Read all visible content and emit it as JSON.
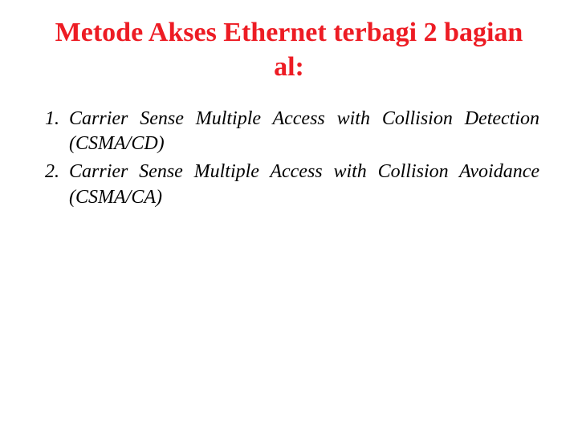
{
  "title": "Metode Akses Ethernet terbagi 2 bagian al:",
  "items": [
    "Carrier Sense Multiple Access with Collision Detection (CSMA/CD)",
    "Carrier Sense Multiple Access with Collision Avoidance (CSMA/CA)"
  ]
}
